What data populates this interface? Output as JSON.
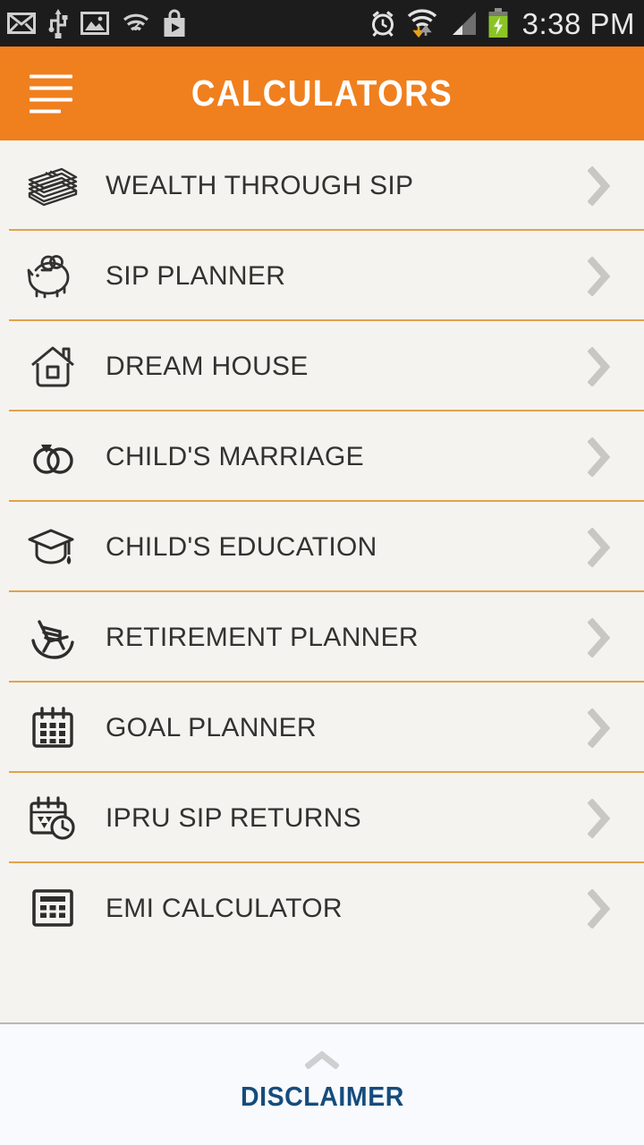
{
  "statusbar": {
    "time": "3:38 PM",
    "left_icons": [
      {
        "name": "mail-icon"
      },
      {
        "name": "usb-icon"
      },
      {
        "name": "image-icon"
      },
      {
        "name": "wifi-question-icon"
      },
      {
        "name": "play-store-icon"
      }
    ],
    "right_icons": [
      {
        "name": "alarm-clock-icon"
      },
      {
        "name": "wifi-transfer-icon"
      },
      {
        "name": "cell-signal-icon"
      },
      {
        "name": "battery-charging-icon"
      }
    ]
  },
  "appbar": {
    "title": "CALCULATORS",
    "menu_label": "Menu",
    "accent_color": "#f07f1e",
    "title_color": "#ffffff"
  },
  "list": {
    "divider_color": "#e2a24c",
    "background_color": "#f4f3ef",
    "text_color": "#333230",
    "chevron_color": "#c9c7c2",
    "items": [
      {
        "label": "WEALTH THROUGH SIP",
        "icon": "money-stack-icon"
      },
      {
        "label": "SIP PLANNER",
        "icon": "piggy-bank-icon"
      },
      {
        "label": "DREAM HOUSE",
        "icon": "house-icon"
      },
      {
        "label": "CHILD'S MARRIAGE",
        "icon": "wedding-rings-icon"
      },
      {
        "label": "CHILD'S EDUCATION",
        "icon": "graduation-cap-icon"
      },
      {
        "label": "RETIREMENT PLANNER",
        "icon": "rocking-chair-icon"
      },
      {
        "label": "GOAL PLANNER",
        "icon": "calendar-icon"
      },
      {
        "label": "IPRU SIP RETURNS",
        "icon": "calendar-clock-icon"
      },
      {
        "label": "EMI CALCULATOR",
        "icon": "calculator-icon"
      }
    ]
  },
  "footer": {
    "label": "DISCLAIMER",
    "label_color": "#154c7c",
    "caret": "expand-up-icon"
  }
}
